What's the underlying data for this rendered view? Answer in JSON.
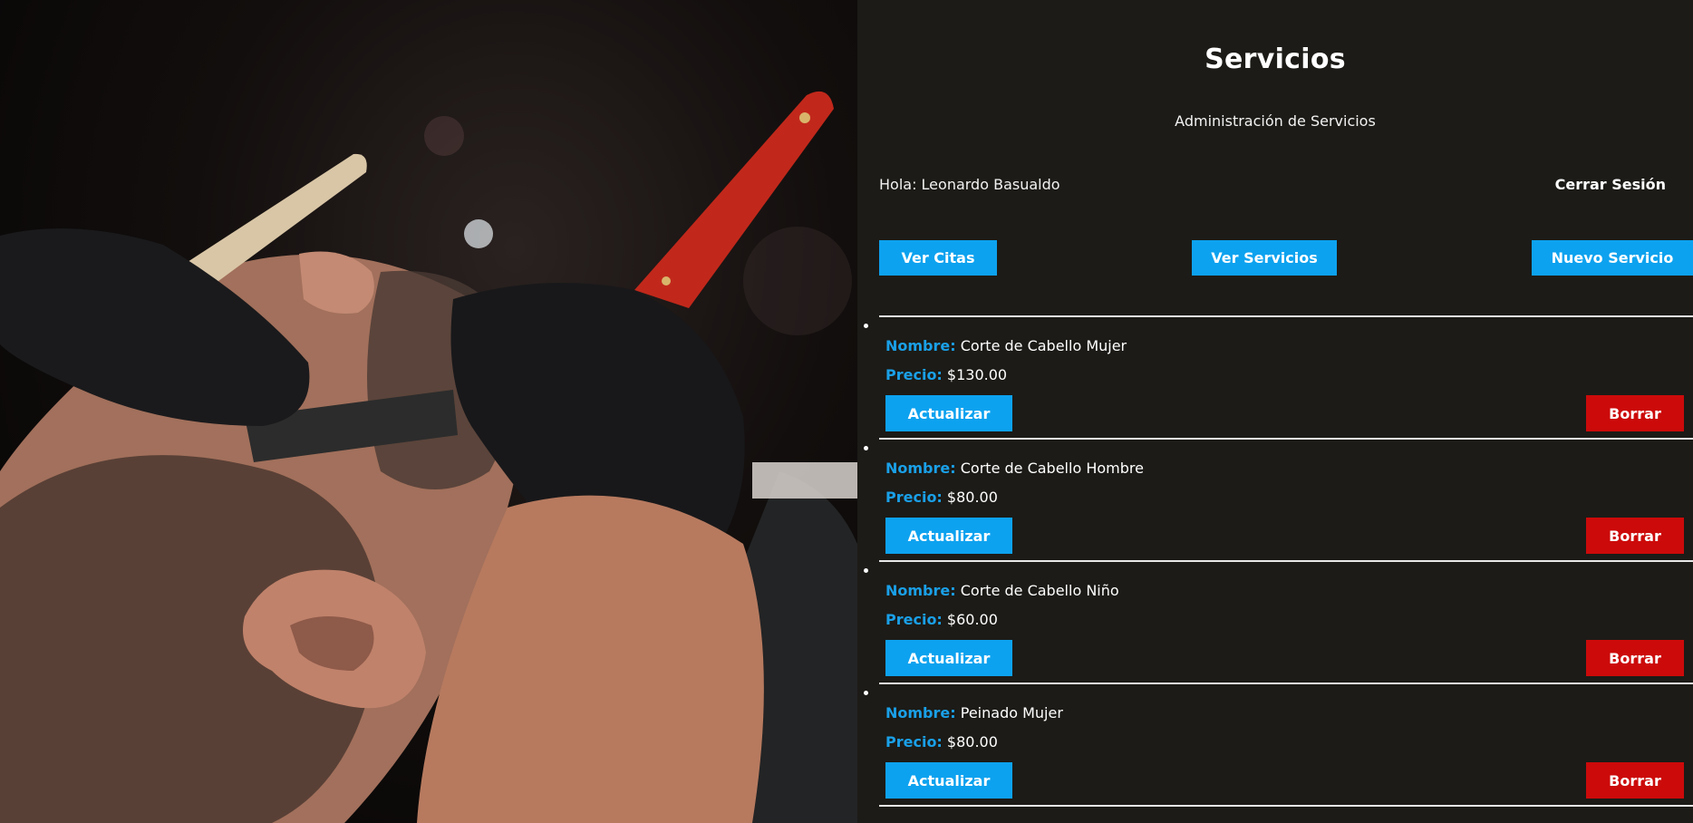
{
  "header": {
    "title": "Servicios",
    "subtitle": "Administración de Servicios"
  },
  "user": {
    "greeting": "Hola: Leonardo Basualdo",
    "logout_label": "Cerrar Sesión"
  },
  "nav": {
    "ver_citas": "Ver Citas",
    "ver_servicios": "Ver Servicios",
    "nuevo_servicio": "Nuevo Servicio"
  },
  "labels": {
    "name": "Nombre:",
    "price": "Precio:",
    "update": "Actualizar",
    "delete": "Borrar"
  },
  "services": [
    {
      "name": "Corte de Cabello Mujer",
      "price": "$130.00"
    },
    {
      "name": "Corte de Cabello Hombre",
      "price": "$80.00"
    },
    {
      "name": "Corte de Cabello Niño",
      "price": "$60.00"
    },
    {
      "name": "Peinado Mujer",
      "price": "$80.00"
    }
  ],
  "colors": {
    "primary": "#0da2ef",
    "danger": "#cc0a0a",
    "background": "#1c1b17"
  }
}
